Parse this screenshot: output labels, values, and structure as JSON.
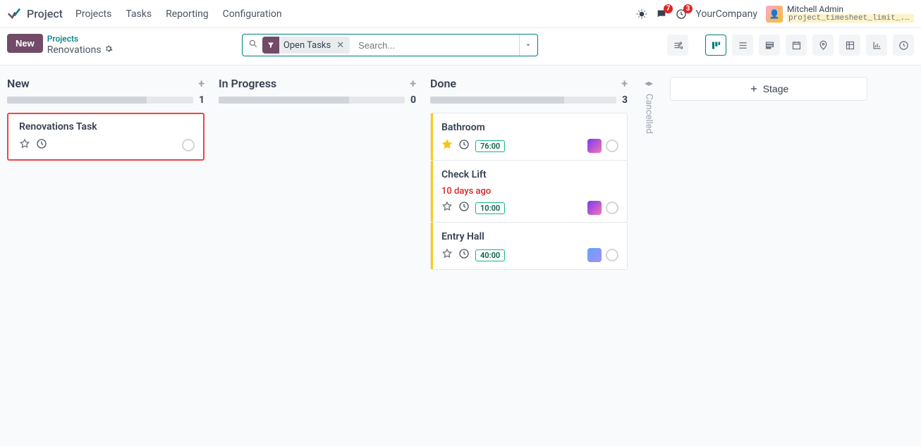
{
  "header": {
    "app_title": "Project",
    "menu": [
      "Projects",
      "Tasks",
      "Reporting",
      "Configuration"
    ],
    "msg_badge": "7",
    "act_badge": "3",
    "company": "YourCompany",
    "user_name": "Mitchell Admin",
    "user_tag": "project_timesheet_limit_..."
  },
  "controls": {
    "new_label": "New",
    "crumb_parent": "Projects",
    "crumb_current": "Renovations",
    "search_chip": "Open Tasks",
    "search_placeholder": "Search...",
    "add_stage_label": "Stage"
  },
  "columns": [
    {
      "title": "New",
      "count": "1",
      "fill_pct": 75,
      "highlight_first": true,
      "tasks": [
        {
          "title": "Renovations Task",
          "starred": false,
          "hours": null,
          "avatar": null,
          "meta": null
        }
      ]
    },
    {
      "title": "In Progress",
      "count": "0",
      "fill_pct": 70,
      "tasks": []
    },
    {
      "title": "Done",
      "count": "3",
      "fill_pct": 72,
      "done": true,
      "tasks": [
        {
          "title": "Bathroom",
          "starred": true,
          "hours": "76:00",
          "avatar": "a",
          "meta": null
        },
        {
          "title": "Check Lift",
          "starred": false,
          "hours": "10:00",
          "avatar": "a",
          "meta": "10 days ago"
        },
        {
          "title": "Entry Hall",
          "starred": false,
          "hours": "40:00",
          "avatar": "b",
          "meta": null
        }
      ]
    }
  ],
  "collapsed": {
    "label": "Cancelled"
  }
}
